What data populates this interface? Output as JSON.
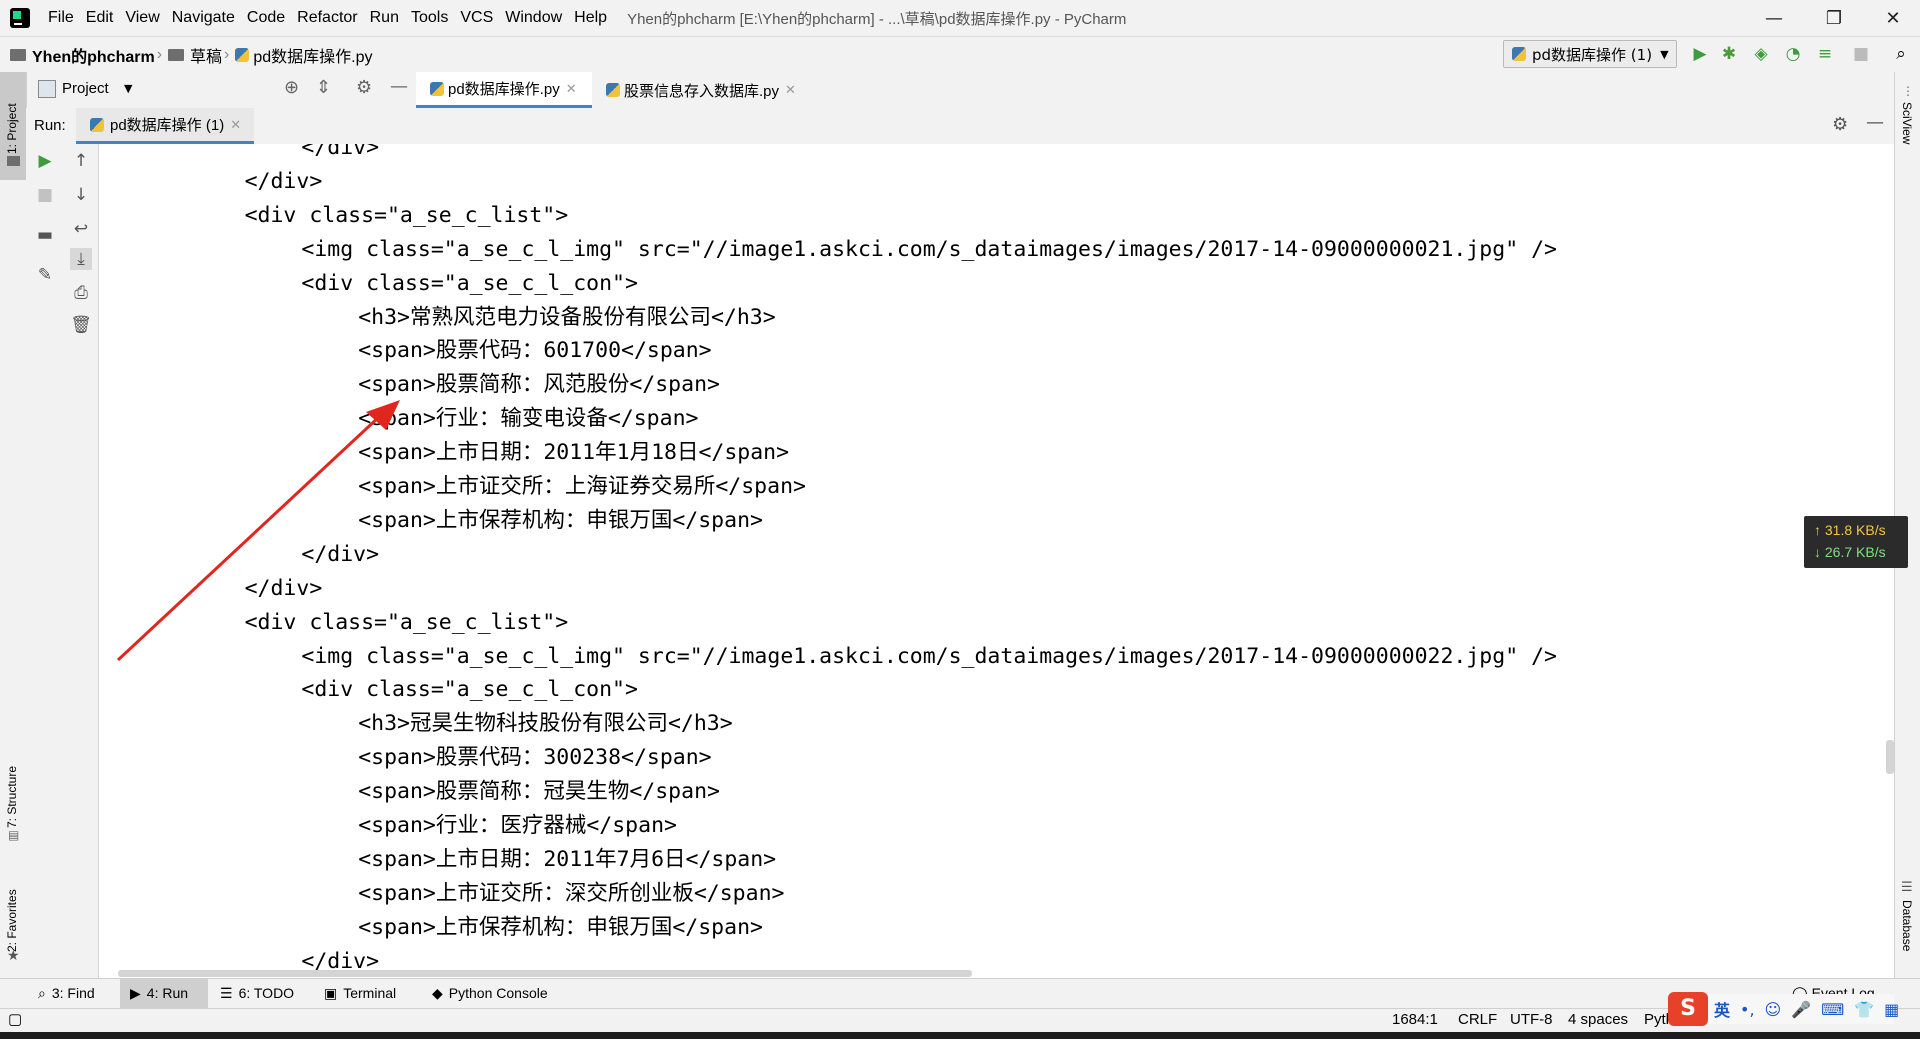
{
  "window": {
    "menu": [
      "File",
      "Edit",
      "View",
      "Navigate",
      "Code",
      "Refactor",
      "Run",
      "Tools",
      "VCS",
      "Window",
      "Help"
    ],
    "title": "Yhen的phcharm [E:\\Yhen的phcharm] - ...\\草稿\\pd数据库操作.py - PyCharm"
  },
  "breadcrumb": [
    "Yhen的phcharm",
    "草稿",
    "pd数据库操作.py"
  ],
  "run_config": "pd数据库操作 (1)",
  "project_label": "Project",
  "editor_tabs": [
    "pd数据库操作.py",
    "股票信息存入数据库.py"
  ],
  "run": {
    "label": "Run:",
    "tab": "pd数据库操作 (1)"
  },
  "left_tabs": {
    "project": "1: Project",
    "structure": "7: Structure",
    "favorites": "2: Favorites"
  },
  "right_tabs": {
    "sciview": "SciView",
    "database": "Database"
  },
  "console_lines": [
    {
      "indent": 6,
      "text": "</div>"
    },
    {
      "indent": 4,
      "text": "</div>"
    },
    {
      "indent": 4,
      "text": "<div class=\"a_se_c_list\">"
    },
    {
      "indent": 6,
      "text": "<img class=\"a_se_c_l_img\" src=\"//image1.askci.com/s_dataimages/images/2017-14-09000000021.jpg\" />"
    },
    {
      "indent": 6,
      "text": "<div class=\"a_se_c_l_con\">"
    },
    {
      "indent": 8,
      "text": "<h3>常熟风范电力设备股份有限公司</h3>"
    },
    {
      "indent": 8,
      "text": "<span>股票代码：601700</span>"
    },
    {
      "indent": 8,
      "text": "<span>股票简称：风范股份</span>"
    },
    {
      "indent": 8,
      "text": "<span>行业：输变电设备</span>"
    },
    {
      "indent": 8,
      "text": "<span>上市日期：2011年1月18日</span>"
    },
    {
      "indent": 8,
      "text": "<span>上市证交所：上海证券交易所</span>"
    },
    {
      "indent": 8,
      "text": "<span>上市保荐机构：申银万国</span>"
    },
    {
      "indent": 6,
      "text": "</div>"
    },
    {
      "indent": 4,
      "text": "</div>"
    },
    {
      "indent": 4,
      "text": "<div class=\"a_se_c_list\">"
    },
    {
      "indent": 6,
      "text": "<img class=\"a_se_c_l_img\" src=\"//image1.askci.com/s_dataimages/images/2017-14-09000000022.jpg\" />"
    },
    {
      "indent": 6,
      "text": "<div class=\"a_se_c_l_con\">"
    },
    {
      "indent": 8,
      "text": "<h3>冠昊生物科技股份有限公司</h3>"
    },
    {
      "indent": 8,
      "text": "<span>股票代码：300238</span>"
    },
    {
      "indent": 8,
      "text": "<span>股票简称：冠昊生物</span>"
    },
    {
      "indent": 8,
      "text": "<span>行业：医疗器械</span>"
    },
    {
      "indent": 8,
      "text": "<span>上市日期：2011年7月6日</span>"
    },
    {
      "indent": 8,
      "text": "<span>上市证交所：深交所创业板</span>"
    },
    {
      "indent": 8,
      "text": "<span>上市保荐机构：申银万国</span>"
    },
    {
      "indent": 6,
      "text": "</div>"
    }
  ],
  "netspeed": {
    "up": "↑ 31.8 KB/s",
    "down": "↓ 26.7 KB/s",
    "up_color": "#f4c542",
    "down_color": "#7ee07e"
  },
  "bottom_tabs": [
    "3: Find",
    "4: Run",
    "6: TODO",
    "Terminal",
    "Python Console"
  ],
  "event_log": "Event Log",
  "status": {
    "position": "1684:1",
    "line_sep": "CRLF",
    "encoding": "UTF-8",
    "indent": "4 spaces",
    "interpreter": "Pyth"
  },
  "ime": {
    "lang": "英"
  },
  "annotation_color": "#e0261e"
}
